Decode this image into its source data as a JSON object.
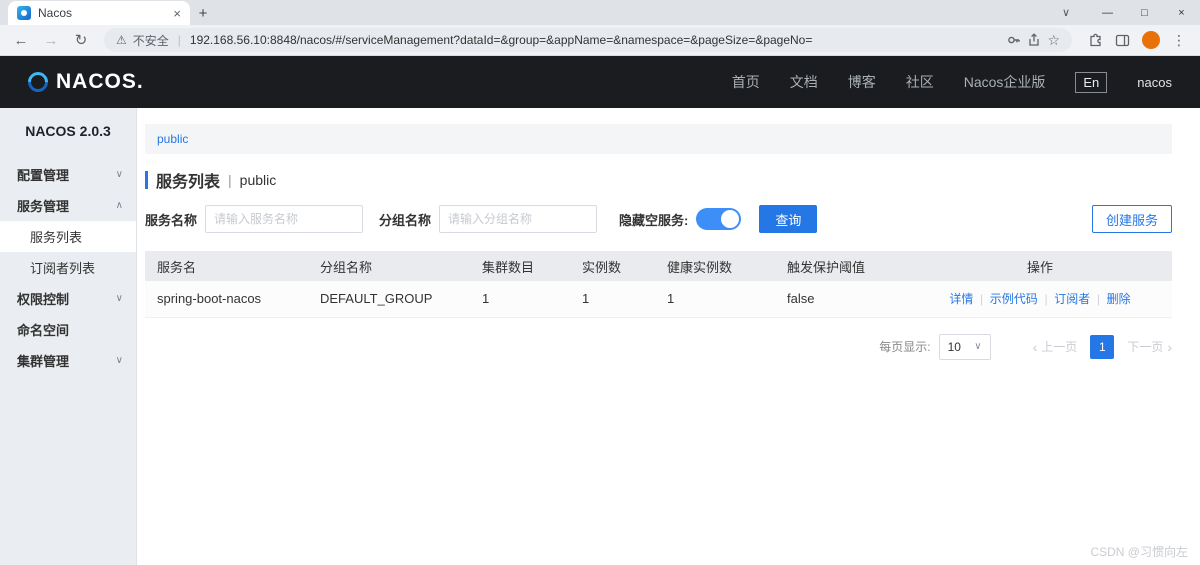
{
  "colors": {
    "accent": "#2577e5",
    "header_bg": "#1a1c1f",
    "sidebar_bg": "#eaedf1",
    "toggle_on": "#3e8ef7"
  },
  "icons": {
    "back": "←",
    "forward": "→",
    "refresh": "↻",
    "warning": "⚠",
    "star": "☆",
    "menu_dots": "⋮",
    "close": "×",
    "new_tab": "+",
    "chevron_down": "∨",
    "chevron_up": "∧",
    "chevron_left": "‹",
    "chevron_right": "›",
    "minimize": "—",
    "maximize": "□",
    "separator": "|"
  },
  "browser": {
    "tab_title": "Nacos",
    "security_label": "不安全",
    "url": "192.168.56.10:8848/nacos/#/serviceManagement?dataId=&group=&appName=&namespace=&pageSize=&pageNo="
  },
  "header": {
    "logo_text": "NACOS.",
    "nav": [
      {
        "label": "首页"
      },
      {
        "label": "文档"
      },
      {
        "label": "博客"
      },
      {
        "label": "社区"
      },
      {
        "label": "Nacos企业版"
      }
    ],
    "lang": "En",
    "user": "nacos"
  },
  "sidebar": {
    "version": "NACOS 2.0.3",
    "items": [
      {
        "label": "配置管理"
      },
      {
        "label": "服务管理",
        "children": [
          {
            "label": "服务列表"
          },
          {
            "label": "订阅者列表"
          }
        ]
      },
      {
        "label": "权限控制"
      },
      {
        "label": "命名空间"
      },
      {
        "label": "集群管理"
      }
    ]
  },
  "main": {
    "namespace_tab": "public",
    "page_title": "服务列表",
    "page_subtitle": "public",
    "filters": {
      "service_name_label": "服务名称",
      "service_name_placeholder": "请输入服务名称",
      "group_name_label": "分组名称",
      "group_name_placeholder": "请输入分组名称",
      "hide_empty_label": "隐藏空服务:",
      "query_button": "查询",
      "create_button": "创建服务"
    },
    "table": {
      "headers": [
        "服务名",
        "分组名称",
        "集群数目",
        "实例数",
        "健康实例数",
        "触发保护阈值",
        "操作"
      ],
      "rows": [
        {
          "service_name": "spring-boot-nacos",
          "group_name": "DEFAULT_GROUP",
          "cluster_count": "1",
          "instance_count": "1",
          "healthy_instance_count": "1",
          "trigger_protection_threshold": "false",
          "actions": [
            "详情",
            "示例代码",
            "订阅者",
            "删除"
          ]
        }
      ]
    },
    "pagination": {
      "per_page_label": "每页显示:",
      "per_page_value": "10",
      "prev": "上一页",
      "current": "1",
      "next": "下一页"
    }
  },
  "watermark": "CSDN @习惯向左"
}
